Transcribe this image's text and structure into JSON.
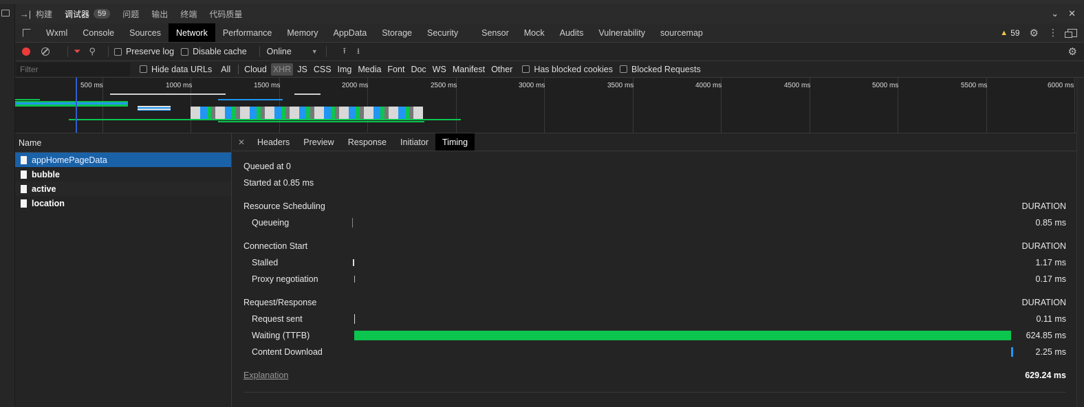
{
  "titlebar": {
    "tabs": [
      {
        "label": "构建"
      },
      {
        "label": "调试器",
        "badge": "59",
        "active": true
      },
      {
        "label": "问题"
      },
      {
        "label": "输出"
      },
      {
        "label": "终端"
      },
      {
        "label": "代码质量"
      }
    ]
  },
  "devtools_tabs": [
    "Wxml",
    "Console",
    "Sources",
    "Network",
    "Performance",
    "Memory",
    "AppData",
    "Storage",
    "Security",
    "Sensor",
    "Mock",
    "Audits",
    "Vulnerability",
    "sourcemap"
  ],
  "active_devtools_tab": "Network",
  "warnings_count": "59",
  "toolbar": {
    "preserve_log": "Preserve log",
    "disable_cache": "Disable cache",
    "throttling": "Online"
  },
  "filter": {
    "placeholder": "Filter",
    "hide_data_urls": "Hide data URLs",
    "types": [
      "All",
      "Cloud",
      "XHR",
      "JS",
      "CSS",
      "Img",
      "Media",
      "Font",
      "Doc",
      "WS",
      "Manifest",
      "Other"
    ],
    "selected_type": "XHR",
    "has_blocked_cookies": "Has blocked cookies",
    "blocked_requests": "Blocked Requests"
  },
  "overview": {
    "ticks": [
      "500 ms",
      "1000 ms",
      "1500 ms",
      "2000 ms",
      "2500 ms",
      "3000 ms",
      "3500 ms",
      "4000 ms",
      "4500 ms",
      "5000 ms",
      "5500 ms",
      "6000 ms"
    ]
  },
  "name_header": "Name",
  "requests": [
    {
      "name": "appHomePageData",
      "selected": true
    },
    {
      "name": "bubble"
    },
    {
      "name": "active"
    },
    {
      "name": "location"
    }
  ],
  "detail_tabs": [
    "Headers",
    "Preview",
    "Response",
    "Initiator",
    "Timing"
  ],
  "active_detail_tab": "Timing",
  "timing": {
    "queued_at": "Queued at 0",
    "started_at": "Started at 0.85 ms",
    "duration_label": "DURATION",
    "sections": [
      {
        "title": "Resource Scheduling",
        "rows": [
          {
            "label": "Queueing",
            "duration": "0.85 ms"
          }
        ]
      },
      {
        "title": "Connection Start",
        "rows": [
          {
            "label": "Stalled",
            "duration": "1.17 ms"
          },
          {
            "label": "Proxy negotiation",
            "duration": "0.17 ms"
          }
        ]
      },
      {
        "title": "Request/Response",
        "rows": [
          {
            "label": "Request sent",
            "duration": "0.11 ms"
          },
          {
            "label": "Waiting (TTFB)",
            "duration": "624.85 ms"
          },
          {
            "label": "Content Download",
            "duration": "2.25 ms"
          }
        ]
      }
    ],
    "explanation": "Explanation",
    "total": "629.24 ms"
  },
  "colors": {
    "waiting": "#0cc54f",
    "download": "#2196f3",
    "selected_row": "#1a62a8",
    "record": "#ed3b3b"
  }
}
